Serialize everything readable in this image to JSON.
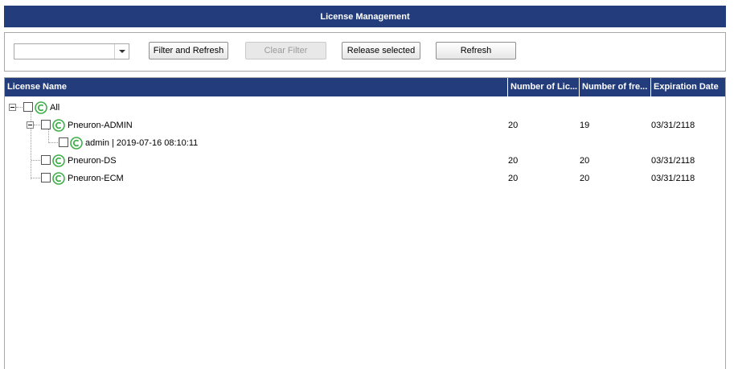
{
  "title": "License Management",
  "toolbar": {
    "filter_value": "",
    "filter_refresh_label": "Filter and Refresh",
    "clear_filter_label": "Clear Filter",
    "release_selected_label": "Release selected",
    "refresh_label": "Refresh"
  },
  "grid": {
    "columns": [
      "License Name",
      "Number of Lic...",
      "Number of fre...",
      "Expiration Date"
    ],
    "rows": [
      {
        "name": "All",
        "licenses": "",
        "free": "",
        "expiration": ""
      },
      {
        "name": "Pneuron-ADMIN",
        "licenses": "20",
        "free": "19",
        "expiration": "03/31/2118"
      },
      {
        "name": "admin | 2019-07-16 08:10:11",
        "licenses": "",
        "free": "",
        "expiration": ""
      },
      {
        "name": "Pneuron-DS",
        "licenses": "20",
        "free": "20",
        "expiration": "03/31/2118"
      },
      {
        "name": "Pneuron-ECM",
        "licenses": "20",
        "free": "20",
        "expiration": "03/31/2118"
      }
    ]
  },
  "colors": {
    "header_bg": "#233d7c",
    "icon_green": "#3fae49"
  },
  "icons": {
    "license": "license-c-icon",
    "collapse": "collapse-minus-icon",
    "dropdown": "chevron-down-icon"
  }
}
